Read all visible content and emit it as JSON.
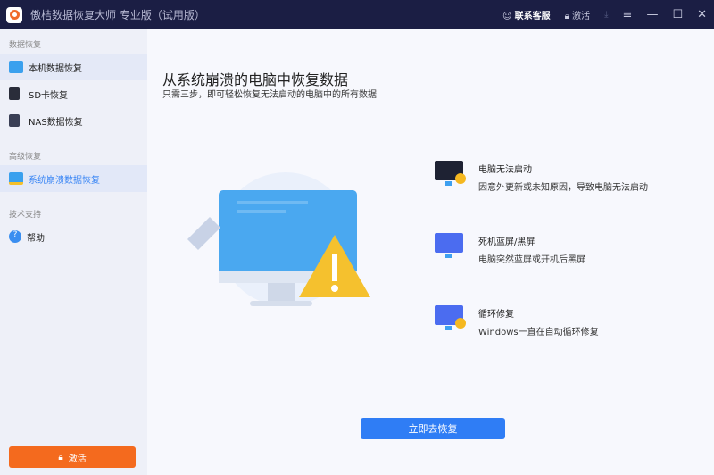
{
  "title": "傲桔数据恢复大师 专业版（试用版）",
  "titlebar": {
    "support": "联系客服",
    "activate": "激活"
  },
  "sidebar": {
    "sections": [
      {
        "label": "数据恢复",
        "items": [
          "本机数据恢复",
          "SD卡恢复",
          "NAS数据恢复"
        ]
      },
      {
        "label": "高级恢复",
        "items": [
          "系统崩溃数据恢复"
        ]
      },
      {
        "label": "技术支持",
        "items": [
          "帮助"
        ]
      }
    ],
    "activate": "激活"
  },
  "main": {
    "title": "从系统崩溃的电脑中恢复数据",
    "subtitle": "只需三步，即可轻松恢复无法启动的电脑中的所有数据",
    "features": [
      {
        "title": "电脑无法启动",
        "desc": "因意外更新或未知原因，导致电脑无法启动"
      },
      {
        "title": "死机蓝屏/黑屏",
        "desc": "电脑突然蓝屏或开机后黑屏"
      },
      {
        "title": "循环修复",
        "desc": "Windows一直在自动循环修复"
      }
    ],
    "button": "立即去恢复"
  }
}
